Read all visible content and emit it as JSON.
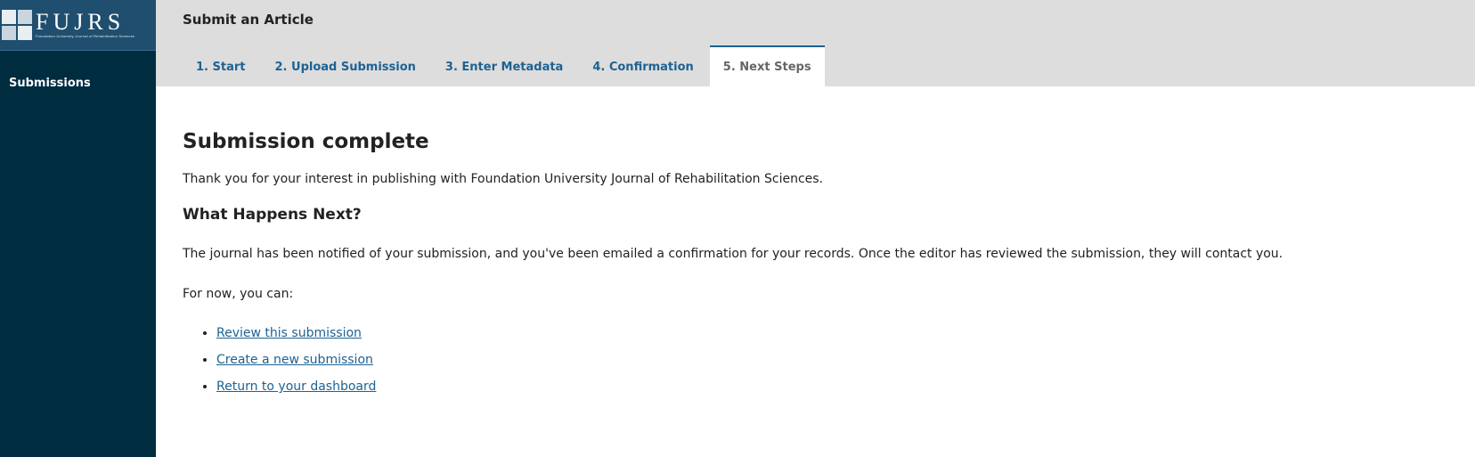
{
  "sidebar": {
    "logo": {
      "letters": "FUJRS",
      "subtitle": "Foundation University Journal of Rehabilitation Sciences"
    },
    "items": [
      {
        "label": "Submissions"
      }
    ]
  },
  "header": {
    "title": "Submit an Article",
    "tabs": [
      {
        "label": "1. Start"
      },
      {
        "label": "2. Upload Submission"
      },
      {
        "label": "3. Enter Metadata"
      },
      {
        "label": "4. Confirmation"
      },
      {
        "label": "5. Next Steps",
        "active": true
      }
    ]
  },
  "main": {
    "heading": "Submission complete",
    "intro": "Thank you for your interest in publishing with Foundation University Journal of Rehabilitation Sciences.",
    "next_heading": "What Happens Next?",
    "notified": "The journal has been notified of your submission, and you've been emailed a confirmation for your records. Once the editor has reviewed the submission, they will contact you.",
    "for_now": "For now, you can:",
    "links": [
      {
        "label": "Review this submission"
      },
      {
        "label": "Create a new submission"
      },
      {
        "label": "Return to your dashboard"
      }
    ]
  },
  "colors": {
    "sidebar": "#002c40",
    "header": "#dddddd",
    "link": "#1e6292",
    "active_tab_text": "#666666"
  }
}
